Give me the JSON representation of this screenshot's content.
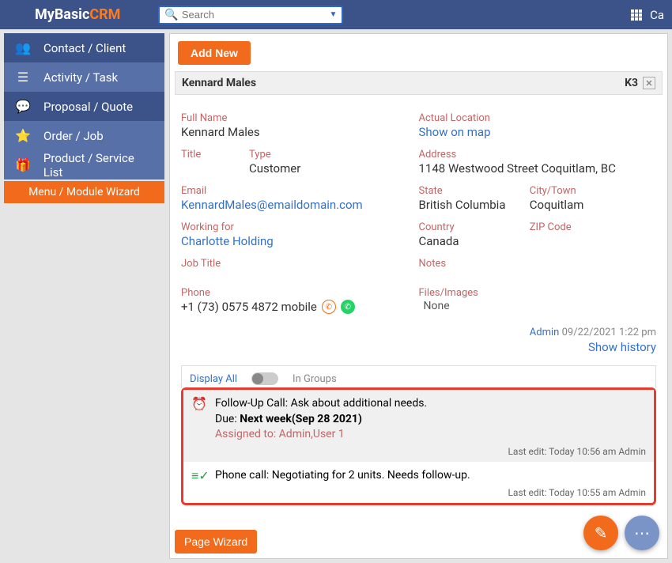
{
  "header": {
    "logo_basic": "MyBasic",
    "logo_crm": "CRM",
    "search_placeholder": "Search",
    "right_text": "Ca"
  },
  "sidebar": {
    "items": [
      {
        "label": "Contact / Client",
        "icon": "👥"
      },
      {
        "label": "Activity / Task",
        "icon": "≡"
      },
      {
        "label": "Proposal / Quote",
        "icon": "▭"
      },
      {
        "label": "Order / Job",
        "icon": "★"
      },
      {
        "label": "Product / Service List",
        "icon": "⊞"
      }
    ],
    "wizard_label": "Menu / Module Wizard"
  },
  "main": {
    "add_new": "Add New",
    "record_name": "Kennard Males",
    "record_code": "K3",
    "fields": {
      "full_name_label": "Full Name",
      "full_name": "Kennard Males",
      "title_label": "Title",
      "type_label": "Type",
      "type": "Customer",
      "email_label": "Email",
      "email": "KennardMales@emaildomain.com",
      "working_for_label": "Working for",
      "working_for": "Charlotte Holding",
      "job_title_label": "Job Title",
      "phone_label": "Phone",
      "phone": "+1 (73) 0575 4872 mobile",
      "location_label": "Actual Location",
      "location_link": "Show on map",
      "address_label": "Address",
      "address": "1148 Westwood Street Coquitlam, BC",
      "state_label": "State",
      "state": "British Columbia",
      "city_label": "City/Town",
      "city": "Coquitlam",
      "country_label": "Country",
      "country": "Canada",
      "zip_label": "ZIP Code",
      "notes_label": "Notes",
      "files_label": "Files/Images",
      "files": "None"
    },
    "meta": {
      "admin_label": "Admin",
      "timestamp": "09/22/2021 1:22 pm",
      "history_link": "Show history"
    },
    "tabs": {
      "display_all": "Display All",
      "in_groups": "In Groups"
    },
    "activities": [
      {
        "title": "Follow-Up Call: Ask about additional needs.",
        "due_prefix": "Due: ",
        "due_bold": "Next week(Sep 28 2021)",
        "assigned": "Assigned to: Admin,User 1",
        "footer": "Last edit: Today 10:56 am Admin"
      },
      {
        "title": "Phone call: Negotiating for 2 units. Needs follow-up.",
        "footer": "Last edit: Today 10:55 am Admin"
      }
    ],
    "page_wizard": "Page Wizard"
  }
}
